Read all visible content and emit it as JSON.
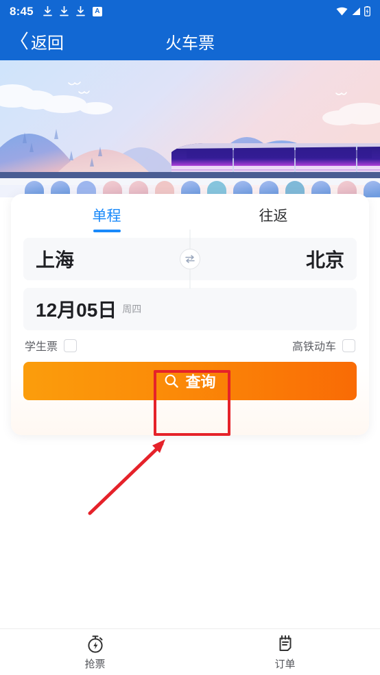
{
  "status_bar": {
    "time": "8:45",
    "left_icons": [
      "download-icon",
      "download-icon",
      "download-icon",
      "a-badge-icon"
    ],
    "a_badge_text": "A",
    "right_icons": [
      "wifi-icon",
      "cellular-signal-icon",
      "battery-charging-icon"
    ],
    "background_color": "#1268d3"
  },
  "nav_bar": {
    "back_label": "返回",
    "back_icon": "chevron-left-icon",
    "title": "火车票"
  },
  "hero": {
    "alt": "高铁穿越山间高架桥插画",
    "icons": [
      "mountain",
      "cloud",
      "bird",
      "high-speed-train",
      "viaduct-arches"
    ]
  },
  "search_card": {
    "tabs": [
      {
        "label": "单程",
        "active": true
      },
      {
        "label": "往返",
        "active": false
      }
    ],
    "active_tab_color": "#1989fa",
    "route": {
      "from": "上海",
      "to": "北京",
      "swap_icon": "swap-horizontal-icon"
    },
    "date": {
      "value": "12月05日",
      "weekday": "周四"
    },
    "options": [
      {
        "label": "学生票",
        "checked": false
      },
      {
        "label": "高铁动车",
        "checked": false
      }
    ],
    "search_button": {
      "label": "查询",
      "icon": "search-icon",
      "gradient_from": "#fb9d0c",
      "gradient_to": "#f96b05"
    }
  },
  "annotation": {
    "highlight_color": "#e5222a",
    "target": "查询",
    "shape": "rectangle-with-arrow"
  },
  "bottom_nav": {
    "items": [
      {
        "label": "抢票",
        "icon": "stopwatch-bolt-icon"
      },
      {
        "label": "订单",
        "icon": "clipboard-icon"
      }
    ]
  }
}
